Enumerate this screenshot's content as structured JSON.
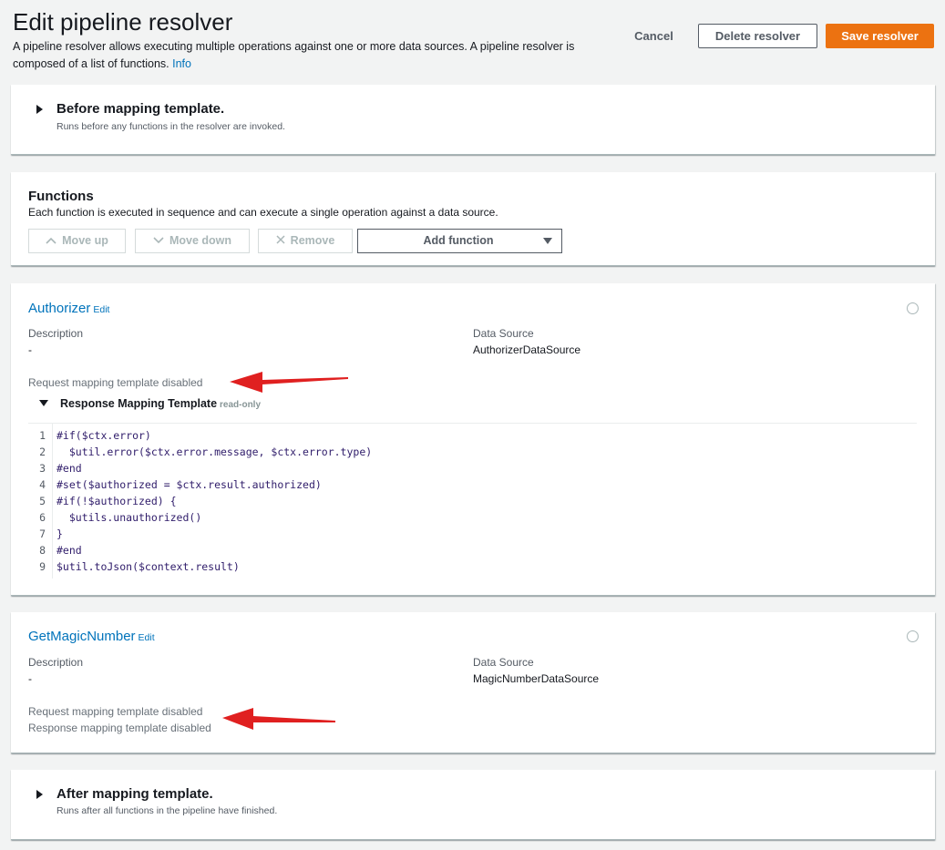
{
  "header": {
    "title": "Edit pipeline resolver",
    "description": "A pipeline resolver allows executing multiple operations against one or more data sources. A pipeline resolver is composed of a list of functions.",
    "info_link": "Info"
  },
  "actions": {
    "cancel": "Cancel",
    "delete": "Delete resolver",
    "save": "Save resolver"
  },
  "before_template": {
    "title": "Before mapping template.",
    "subtitle": "Runs before any functions in the resolver are invoked."
  },
  "functions": {
    "title": "Functions",
    "description": "Each function is executed in sequence and can execute a single operation against a data source.",
    "move_up": "Move up",
    "move_down": "Move down",
    "remove": "Remove",
    "add_function": "Add function"
  },
  "function_cards": [
    {
      "name": "Authorizer",
      "edit": "Edit",
      "description_label": "Description",
      "description_value": "-",
      "datasource_label": "Data Source",
      "datasource_value": "AuthorizerDataSource",
      "request_status": "Request mapping template disabled",
      "response_title": "Response Mapping Template",
      "response_badge": "read-only",
      "code_lines": [
        "#if($ctx.error)",
        "  $util.error($ctx.error.message, $ctx.error.type)",
        "#end",
        "#set($authorized = $ctx.result.authorized)",
        "#if(!$authorized) {",
        "  $utils.unauthorized()",
        "}",
        "#end",
        "$util.toJson($context.result)"
      ],
      "line_numbers": [
        "1",
        "2",
        "3",
        "4",
        "5",
        "6",
        "7",
        "8",
        "9"
      ]
    },
    {
      "name": "GetMagicNumber",
      "edit": "Edit",
      "description_label": "Description",
      "description_value": "-",
      "datasource_label": "Data Source",
      "datasource_value": "MagicNumberDataSource",
      "request_status": "Request mapping template disabled",
      "response_status": "Response mapping template disabled"
    }
  ],
  "after_template": {
    "title": "After mapping template.",
    "subtitle": "Runs after all functions in the pipeline have finished."
  },
  "colors": {
    "primary_button": "#ec7211",
    "link": "#0073bb",
    "annotation_arrow": "#e02020"
  }
}
